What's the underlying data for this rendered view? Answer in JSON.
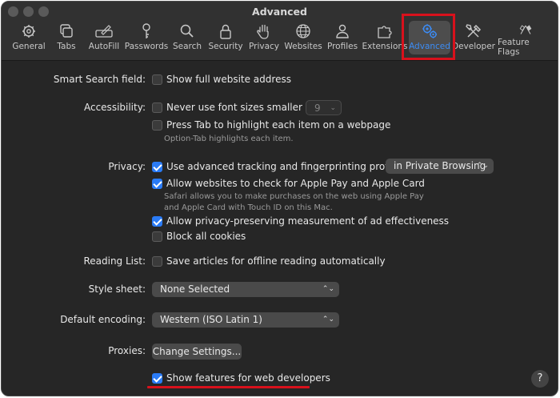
{
  "window": {
    "title": "Advanced"
  },
  "toolbar": {
    "items": [
      {
        "label": "General",
        "icon": "gear-icon"
      },
      {
        "label": "Tabs",
        "icon": "tabs-icon"
      },
      {
        "label": "AutoFill",
        "icon": "pencil-icon"
      },
      {
        "label": "Passwords",
        "icon": "key-icon"
      },
      {
        "label": "Search",
        "icon": "magnifier-icon"
      },
      {
        "label": "Security",
        "icon": "lock-icon"
      },
      {
        "label": "Privacy",
        "icon": "hand-icon"
      },
      {
        "label": "Websites",
        "icon": "globe-icon"
      },
      {
        "label": "Profiles",
        "icon": "person-icon"
      },
      {
        "label": "Extensions",
        "icon": "puzzle-icon"
      },
      {
        "label": "Advanced",
        "icon": "gears-icon",
        "active": true
      },
      {
        "label": "Developer",
        "icon": "tools-icon"
      },
      {
        "label": "Feature Flags",
        "icon": "flags-icon"
      }
    ]
  },
  "smart_search": {
    "label": "Smart Search field:",
    "option": "Show full website address",
    "checked": false
  },
  "accessibility": {
    "label": "Accessibility:",
    "font_option": "Never use font sizes smaller than",
    "font_size": "9",
    "tab_option": "Press Tab to highlight each item on a webpage",
    "tab_hint": "Option-Tab highlights each item."
  },
  "privacy": {
    "label": "Privacy:",
    "tracking_option": "Use advanced tracking and fingerprinting protection",
    "tracking_scope": "in Private Browsing",
    "applepay_option": "Allow websites to check for Apple Pay and Apple Card",
    "applepay_hint_1": "Safari allows you to make purchases on the web using Apple Pay",
    "applepay_hint_2": "and Apple Card with Touch ID on this Mac.",
    "ad_option": "Allow privacy-preserving measurement of ad effectiveness",
    "cookies_option": "Block all cookies"
  },
  "reading_list": {
    "label": "Reading List:",
    "option": "Save articles for offline reading automatically"
  },
  "style_sheet": {
    "label": "Style sheet:",
    "value": "None Selected"
  },
  "encoding": {
    "label": "Default encoding:",
    "value": "Western (ISO Latin 1)"
  },
  "proxies": {
    "label": "Proxies:",
    "button": "Change Settings..."
  },
  "developer": {
    "option": "Show features for web developers",
    "checked": true
  },
  "help": {
    "label": "?"
  },
  "colors": {
    "accent": "#2a7bf6",
    "highlight": "#d8111c",
    "background": "#262626"
  }
}
